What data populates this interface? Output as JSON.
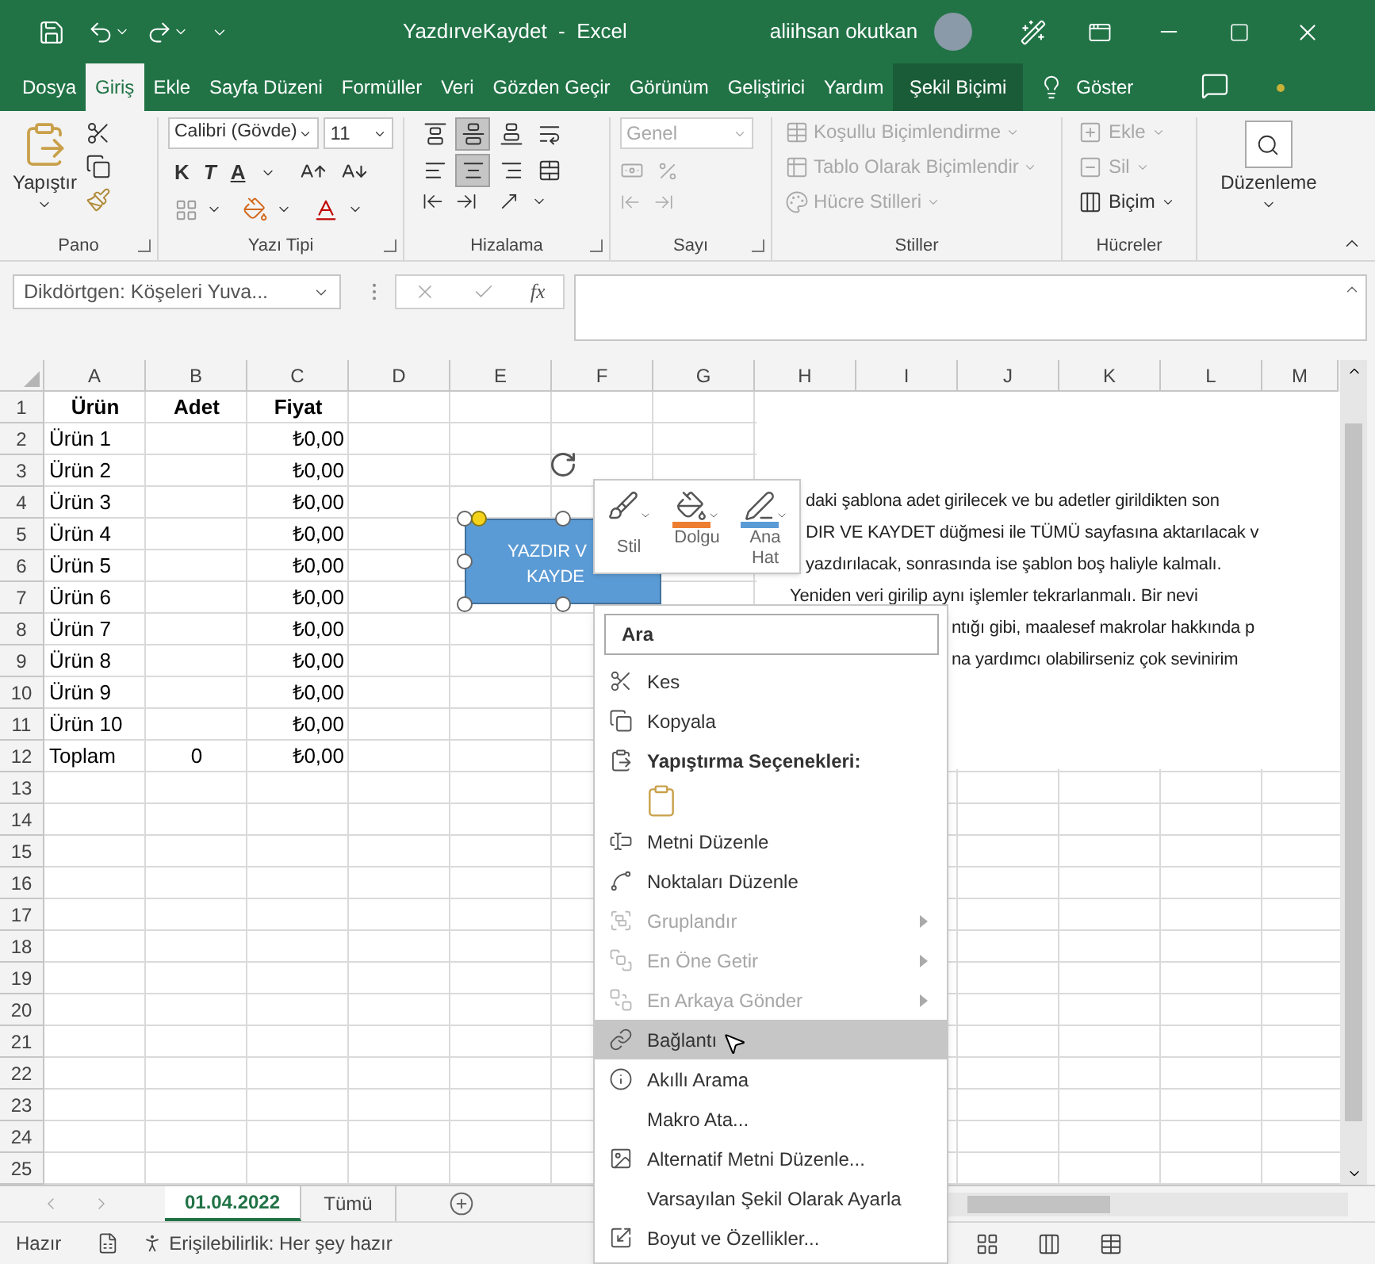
{
  "title_bar": {
    "title": "YazdırveKaydet  -  Excel",
    "user": "aliihsan okutkan"
  },
  "tabs": [
    {
      "label": "Dosya",
      "selected": false,
      "kind": "normal"
    },
    {
      "label": "Giriş",
      "selected": true,
      "kind": "normal"
    },
    {
      "label": "Ekle",
      "selected": false,
      "kind": "normal"
    },
    {
      "label": "Sayfa Düzeni",
      "selected": false,
      "kind": "normal"
    },
    {
      "label": "Formüller",
      "selected": false,
      "kind": "normal"
    },
    {
      "label": "Veri",
      "selected": false,
      "kind": "normal"
    },
    {
      "label": "Gözden Geçir",
      "selected": false,
      "kind": "normal"
    },
    {
      "label": "Görünüm",
      "selected": false,
      "kind": "normal"
    },
    {
      "label": "Geliştirici",
      "selected": false,
      "kind": "normal"
    },
    {
      "label": "Yardım",
      "selected": false,
      "kind": "normal"
    },
    {
      "label": "Şekil Biçimi",
      "selected": false,
      "kind": "contextual"
    },
    {
      "label": "Göster",
      "selected": false,
      "kind": "search"
    }
  ],
  "ribbon": {
    "clipboard": {
      "label": "Pano",
      "paste": "Yapıştır"
    },
    "font": {
      "label": "Yazı Tipi",
      "font_name": "Calibri (Gövde)",
      "font_size": "11",
      "bold": "K",
      "italic": "T",
      "underline": "A"
    },
    "alignment": {
      "label": "Hizalama",
      "buttons": [
        {
          "selected": false
        },
        {
          "selected": true
        },
        {
          "selected": false
        },
        {
          "selected": false
        },
        {
          "selected": false
        },
        {
          "selected": true
        },
        {
          "selected": false
        },
        {
          "selected": false
        }
      ]
    },
    "number": {
      "label": "Sayı",
      "format": "Genel",
      "disabled": true
    },
    "styles": {
      "label": "Stiller",
      "items": [
        {
          "label": "Koşullu Biçimlendirme",
          "disabled": true
        },
        {
          "label": "Tablo Olarak Biçimlendir",
          "disabled": true
        },
        {
          "label": "Hücre Stilleri",
          "disabled": true
        }
      ]
    },
    "cells": {
      "label": "Hücreler",
      "items": [
        {
          "label": "Ekle",
          "disabled": true
        },
        {
          "label": "Sil",
          "disabled": true
        },
        {
          "label": "Biçim",
          "disabled": false
        }
      ]
    },
    "editing": {
      "label": "Düzenleme"
    }
  },
  "formula_bar": {
    "name_box": "Dikdörtgen: Köşeleri Yuva...",
    "function_label": "fx"
  },
  "sheet": {
    "columns": [
      "A",
      "B",
      "C",
      "D",
      "E",
      "F",
      "G",
      "H",
      "I",
      "J",
      "K",
      "L",
      "M"
    ],
    "rows": [
      {
        "number": "1",
        "kind": "header",
        "cells": {
          "A": "Ürün",
          "B": "Adet",
          "C": "Fiyat"
        }
      },
      {
        "number": "2",
        "kind": "data",
        "cells": {
          "A": "Ürün 1",
          "C": "₺0,00"
        }
      },
      {
        "number": "3",
        "kind": "data",
        "cells": {
          "A": "Ürün 2",
          "C": "₺0,00"
        }
      },
      {
        "number": "4",
        "kind": "data",
        "cells": {
          "A": "Ürün 3",
          "C": "₺0,00"
        }
      },
      {
        "number": "5",
        "kind": "data",
        "cells": {
          "A": "Ürün 4",
          "C": "₺0,00"
        }
      },
      {
        "number": "6",
        "kind": "data",
        "cells": {
          "A": "Ürün 5",
          "C": "₺0,00"
        }
      },
      {
        "number": "7",
        "kind": "data",
        "cells": {
          "A": "Ürün 6",
          "C": "₺0,00"
        }
      },
      {
        "number": "8",
        "kind": "data",
        "cells": {
          "A": "Ürün 7",
          "C": "₺0,00"
        }
      },
      {
        "number": "9",
        "kind": "data",
        "cells": {
          "A": "Ürün 8",
          "C": "₺0,00"
        }
      },
      {
        "number": "10",
        "kind": "data",
        "cells": {
          "A": "Ürün 9",
          "C": "₺0,00"
        }
      },
      {
        "number": "11",
        "kind": "data",
        "cells": {
          "A": "Ürün 10",
          "C": "₺0,00"
        }
      },
      {
        "number": "12",
        "kind": "data",
        "cells": {
          "A": "Toplam",
          "B": "0",
          "C": "₺0,00"
        }
      },
      {
        "number": "13",
        "kind": "data"
      },
      {
        "number": "14",
        "kind": "data"
      },
      {
        "number": "15",
        "kind": "data"
      },
      {
        "number": "16",
        "kind": "data"
      },
      {
        "number": "17",
        "kind": "data"
      },
      {
        "number": "18",
        "kind": "data"
      },
      {
        "number": "19",
        "kind": "data"
      },
      {
        "number": "20",
        "kind": "data"
      },
      {
        "number": "21",
        "kind": "data"
      },
      {
        "number": "22",
        "kind": "data"
      },
      {
        "number": "23",
        "kind": "data"
      },
      {
        "number": "24",
        "kind": "data"
      },
      {
        "number": "25",
        "kind": "data"
      }
    ]
  },
  "shape": {
    "lines": [
      "YAZDIR V",
      "KAYDE"
    ]
  },
  "mini_toolbar": [
    {
      "label": "Stil"
    },
    {
      "label": "Dolgu",
      "color": "#ed7d31"
    },
    {
      "label": "Ana Hat",
      "color": "#5b9bd5"
    }
  ],
  "note_lines": [
    "daki şablona adet girilecek ve bu adetler girildikten son",
    "DIR VE KAYDET düğmesi ile TÜMÜ sayfasına aktarılacak v",
    "yazdırılacak, sonrasında ise şablon boş haliyle kalmalı.",
    "Yeniden veri girilip aynı işlemler tekrarlanmalı. Bir nevi",
    "ntığı gibi, maalesef makrolar hakkında p",
    "na yardımcı olabilirseniz çok sevinirim"
  ],
  "context_menu": {
    "placeholder": "Ara",
    "items": [
      {
        "label": "Kes",
        "kind": "item",
        "disabled": false,
        "selected": false,
        "submenu": false
      },
      {
        "label": "Kopyala",
        "kind": "item",
        "disabled": false,
        "selected": false,
        "submenu": false
      },
      {
        "label": "Yapıştırma Seçenekleri:",
        "kind": "header",
        "disabled": false,
        "selected": false,
        "submenu": false
      },
      {
        "kind": "paste-option"
      },
      {
        "label": "Metni Düzenle",
        "kind": "item",
        "disabled": false,
        "selected": false,
        "submenu": false
      },
      {
        "label": "Noktaları Düzenle",
        "kind": "item",
        "disabled": false,
        "selected": false,
        "submenu": false
      },
      {
        "label": "Gruplandır",
        "kind": "item",
        "disabled": true,
        "selected": false,
        "submenu": true
      },
      {
        "label": "En Öne Getir",
        "kind": "item",
        "disabled": true,
        "selected": false,
        "submenu": true
      },
      {
        "label": "En Arkaya Gönder",
        "kind": "item",
        "disabled": true,
        "selected": false,
        "submenu": true
      },
      {
        "label": "Bağlantı",
        "kind": "item",
        "disabled": false,
        "selected": true,
        "submenu": false
      },
      {
        "label": "Akıllı Arama",
        "kind": "item",
        "disabled": false,
        "selected": false,
        "submenu": false
      },
      {
        "label": "Makro Ata...",
        "kind": "item",
        "disabled": false,
        "selected": false,
        "submenu": false
      },
      {
        "label": "Alternatif Metni Düzenle...",
        "kind": "item",
        "disabled": false,
        "selected": false,
        "submenu": false
      },
      {
        "label": "Varsayılan Şekil Olarak Ayarla",
        "kind": "item",
        "disabled": false,
        "selected": false,
        "submenu": false
      },
      {
        "label": "Boyut ve Özellikler...",
        "kind": "item",
        "disabled": false,
        "selected": false,
        "submenu": false
      }
    ]
  },
  "sheet_tabs": [
    {
      "label": "01.04.2022",
      "selected": true
    },
    {
      "label": "Tümü",
      "selected": false
    }
  ],
  "status_bar": {
    "mode": "Hazır",
    "accessibility": "Erişilebilirlik: Her şey hazır"
  }
}
